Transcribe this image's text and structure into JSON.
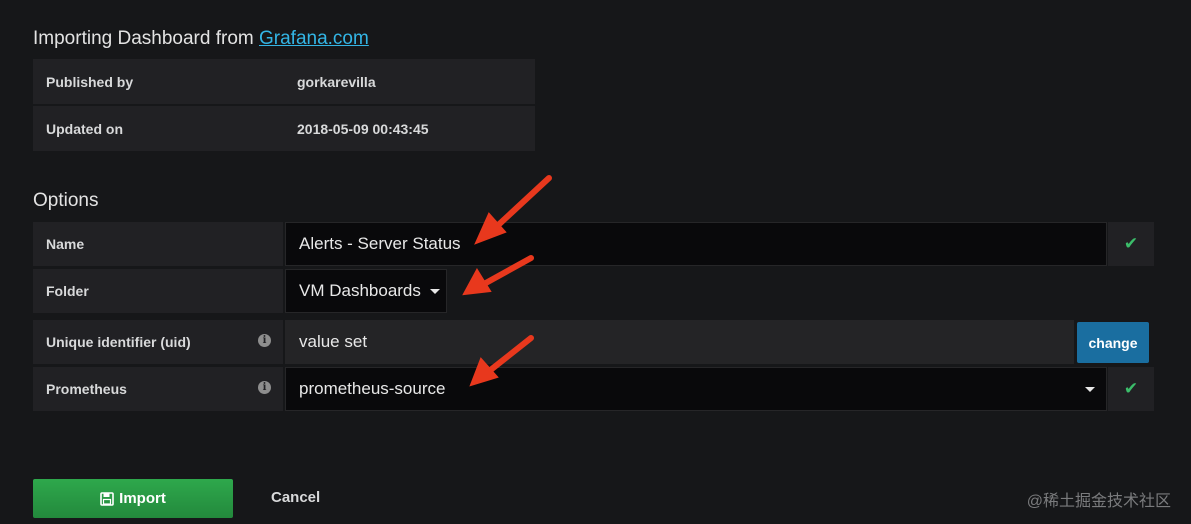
{
  "header": {
    "title_prefix": "Importing Dashboard from ",
    "title_link": "Grafana.com"
  },
  "info": {
    "published_by_label": "Published by",
    "published_by_value": "gorkarevilla",
    "updated_on_label": "Updated on",
    "updated_on_value": "2018-05-09 00:43:45"
  },
  "options": {
    "section_title": "Options",
    "name_label": "Name",
    "name_value": "Alerts - Server Status",
    "folder_label": "Folder",
    "folder_value": "VM Dashboards",
    "uid_label": "Unique identifier (uid)",
    "uid_value": "value set",
    "uid_change_label": "change",
    "prometheus_label": "Prometheus",
    "prometheus_value": "prometheus-source"
  },
  "actions": {
    "import_label": "Import",
    "cancel_label": "Cancel"
  },
  "watermark": "@稀土掘金技术社区",
  "colors": {
    "background": "#161719",
    "accent_link": "#33b5e5",
    "import_button": "#2ea84c",
    "change_button": "#1a6ea0",
    "check": "#3bbd6a",
    "annotation_arrow": "#e8381d"
  },
  "icons": {
    "valid": "check-icon",
    "info": "info-icon",
    "dropdown": "caret-down-icon",
    "save": "save-icon"
  }
}
